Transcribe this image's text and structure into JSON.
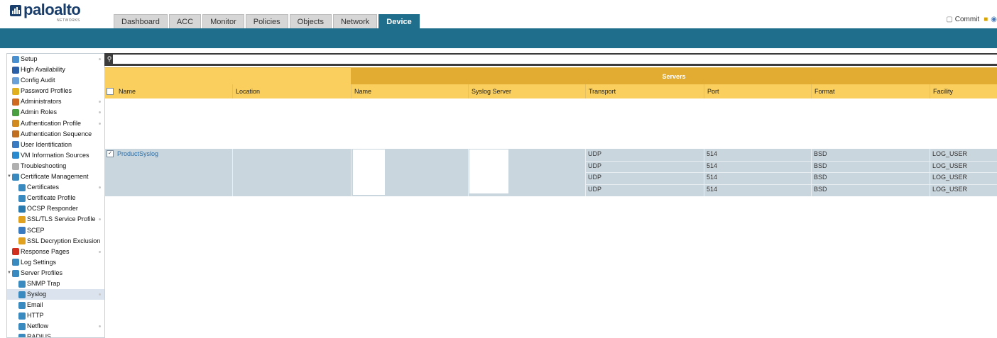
{
  "brand": {
    "name": "paloalto",
    "tagline": "NETWORKS"
  },
  "tabs": [
    {
      "label": "Dashboard",
      "active": false
    },
    {
      "label": "ACC",
      "active": false
    },
    {
      "label": "Monitor",
      "active": false
    },
    {
      "label": "Policies",
      "active": false
    },
    {
      "label": "Objects",
      "active": false
    },
    {
      "label": "Network",
      "active": false
    },
    {
      "label": "Device",
      "active": true
    }
  ],
  "toolbar": {
    "commit_label": "Commit"
  },
  "search": {
    "placeholder": "",
    "value": ""
  },
  "sidebar": {
    "items": [
      {
        "label": "Setup",
        "icon": "setup-icon",
        "color": "#4a8fd0",
        "level": 0,
        "dot": true
      },
      {
        "label": "High Availability",
        "icon": "high-availability-icon",
        "color": "#2b5fa8",
        "level": 0,
        "dot": false
      },
      {
        "label": "Config Audit",
        "icon": "config-audit-icon",
        "color": "#6aa0d8",
        "level": 0,
        "dot": false
      },
      {
        "label": "Password Profiles",
        "icon": "password-profiles-icon",
        "color": "#e0b020",
        "level": 0,
        "dot": false
      },
      {
        "label": "Administrators",
        "icon": "administrators-icon",
        "color": "#d06a20",
        "level": 0,
        "dot": true
      },
      {
        "label": "Admin Roles",
        "icon": "admin-roles-icon",
        "color": "#4aa040",
        "level": 0,
        "dot": true
      },
      {
        "label": "Authentication Profile",
        "icon": "authentication-profile-icon",
        "color": "#d08a20",
        "level": 0,
        "dot": true
      },
      {
        "label": "Authentication Sequence",
        "icon": "authentication-sequence-icon",
        "color": "#c07020",
        "level": 0,
        "dot": false
      },
      {
        "label": "User Identification",
        "icon": "user-identification-icon",
        "color": "#3a7ac0",
        "level": 0,
        "dot": false
      },
      {
        "label": "VM Information Sources",
        "icon": "vm-information-sources-icon",
        "color": "#2a8ad0",
        "level": 0,
        "dot": false
      },
      {
        "label": "Troubleshooting",
        "icon": "troubleshooting-icon",
        "color": "#b0b0b0",
        "level": 0,
        "dot": false
      },
      {
        "label": "Certificate Management",
        "icon": "certificate-management-icon",
        "color": "#3a8ac0",
        "level": 0,
        "dot": false,
        "expanded": true
      },
      {
        "label": "Certificates",
        "icon": "certificates-icon",
        "color": "#3a8ac0",
        "level": 1,
        "dot": true
      },
      {
        "label": "Certificate Profile",
        "icon": "certificate-profile-icon",
        "color": "#3a8ac0",
        "level": 1,
        "dot": false
      },
      {
        "label": "OCSP Responder",
        "icon": "ocsp-responder-icon",
        "color": "#2a7ab0",
        "level": 1,
        "dot": false
      },
      {
        "label": "SSL/TLS Service Profile",
        "icon": "ssl-tls-service-profile-icon",
        "color": "#e0a020",
        "level": 1,
        "dot": true
      },
      {
        "label": "SCEP",
        "icon": "scep-icon",
        "color": "#3a7ac0",
        "level": 1,
        "dot": false
      },
      {
        "label": "SSL Decryption Exclusion",
        "icon": "ssl-decryption-exclusion-icon",
        "color": "#e0a020",
        "level": 1,
        "dot": false
      },
      {
        "label": "Response Pages",
        "icon": "response-pages-icon",
        "color": "#d03020",
        "level": 0,
        "dot": true
      },
      {
        "label": "Log Settings",
        "icon": "log-settings-icon",
        "color": "#3a8ac0",
        "level": 0,
        "dot": false
      },
      {
        "label": "Server Profiles",
        "icon": "server-profiles-icon",
        "color": "#3a8ac0",
        "level": 0,
        "dot": false,
        "expanded": true
      },
      {
        "label": "SNMP Trap",
        "icon": "snmp-trap-icon",
        "color": "#3a8ac0",
        "level": 1,
        "dot": false
      },
      {
        "label": "Syslog",
        "icon": "syslog-icon",
        "color": "#3a8ac0",
        "level": 1,
        "dot": true,
        "selected": true
      },
      {
        "label": "Email",
        "icon": "email-icon",
        "color": "#3a8ac0",
        "level": 1,
        "dot": false
      },
      {
        "label": "HTTP",
        "icon": "http-icon",
        "color": "#3a8ac0",
        "level": 1,
        "dot": false
      },
      {
        "label": "Netflow",
        "icon": "netflow-icon",
        "color": "#3a8ac0",
        "level": 1,
        "dot": true
      },
      {
        "label": "RADIUS",
        "icon": "radius-icon",
        "color": "#3a8ac0",
        "level": 1,
        "dot": false
      }
    ]
  },
  "table": {
    "group_header": "Servers",
    "columns": [
      "Name",
      "Location",
      "Name",
      "Syslog Server",
      "Transport",
      "Port",
      "Format",
      "Facility"
    ],
    "profile": {
      "name": "ProductSyslog",
      "checked": true,
      "location": ""
    },
    "servers": [
      {
        "transport": "UDP",
        "port": "514",
        "format": "BSD",
        "facility": "LOG_USER"
      },
      {
        "transport": "UDP",
        "port": "514",
        "format": "BSD",
        "facility": "LOG_USER"
      },
      {
        "transport": "UDP",
        "port": "514",
        "format": "BSD",
        "facility": "LOG_USER"
      },
      {
        "transport": "UDP",
        "port": "514",
        "format": "BSD",
        "facility": "LOG_USER"
      }
    ]
  },
  "colors": {
    "accent": "#1f6e8c",
    "header_yellow": "#fbcf5e",
    "servers_band": "#e2ac32",
    "row_bg": "#cad6de"
  }
}
